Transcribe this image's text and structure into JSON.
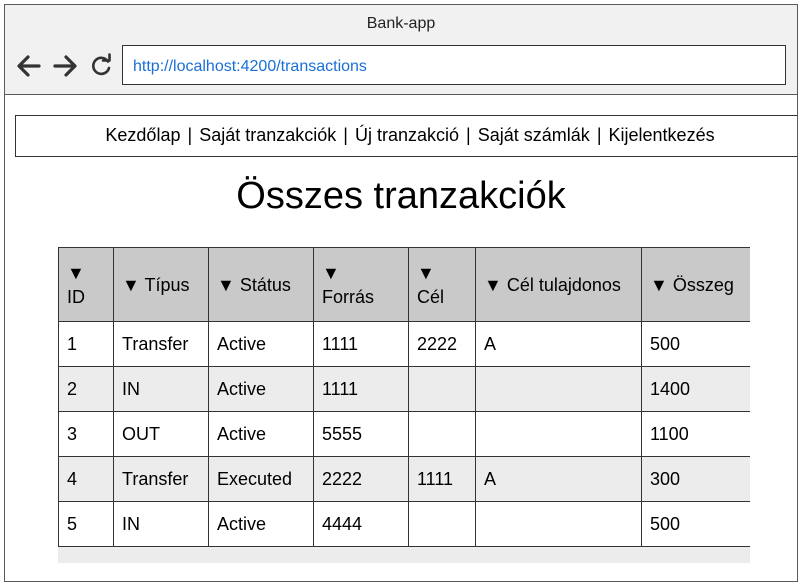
{
  "window": {
    "title": "Bank-app",
    "url": "http://localhost:4200/transactions"
  },
  "icons": {
    "back": "arrow-left-icon",
    "forward": "arrow-right-icon",
    "reload": "reload-icon"
  },
  "menu": {
    "items": [
      {
        "label": "Kezdőlap"
      },
      {
        "label": "Saját tranzakciók"
      },
      {
        "label": "Új tranzakció"
      },
      {
        "label": "Saját számlák"
      },
      {
        "label": "Kijelentkezés"
      }
    ],
    "separator": "|"
  },
  "page": {
    "title": "Összes tranzakciók"
  },
  "table": {
    "sort_glyph": "▼",
    "columns": [
      {
        "label": "ID"
      },
      {
        "label": "Típus"
      },
      {
        "label": "Státus"
      },
      {
        "label": "Forrás"
      },
      {
        "label": "Cél"
      },
      {
        "label": "Cél tulajdonos"
      },
      {
        "label": "Összeg"
      }
    ],
    "rows": [
      {
        "id": "1",
        "type": "Transfer",
        "status": "Active",
        "source": "1111",
        "target": "2222",
        "owner": "A",
        "amount": "500"
      },
      {
        "id": "2",
        "type": "IN",
        "status": "Active",
        "source": "1111",
        "target": "",
        "owner": "",
        "amount": "1400"
      },
      {
        "id": "3",
        "type": "OUT",
        "status": "Active",
        "source": "5555",
        "target": "",
        "owner": "",
        "amount": "1100"
      },
      {
        "id": "4",
        "type": "Transfer",
        "status": "Executed",
        "source": "2222",
        "target": "1111",
        "owner": "A",
        "amount": "300"
      },
      {
        "id": "5",
        "type": "IN",
        "status": "Active",
        "source": "4444",
        "target": "",
        "owner": "",
        "amount": "500"
      }
    ]
  },
  "colors": {
    "url_text": "#1a6fd6",
    "header_bg": "#c9c9c9",
    "alt_row_bg": "#ececec",
    "chrome_bg": "#f1f1f1"
  }
}
